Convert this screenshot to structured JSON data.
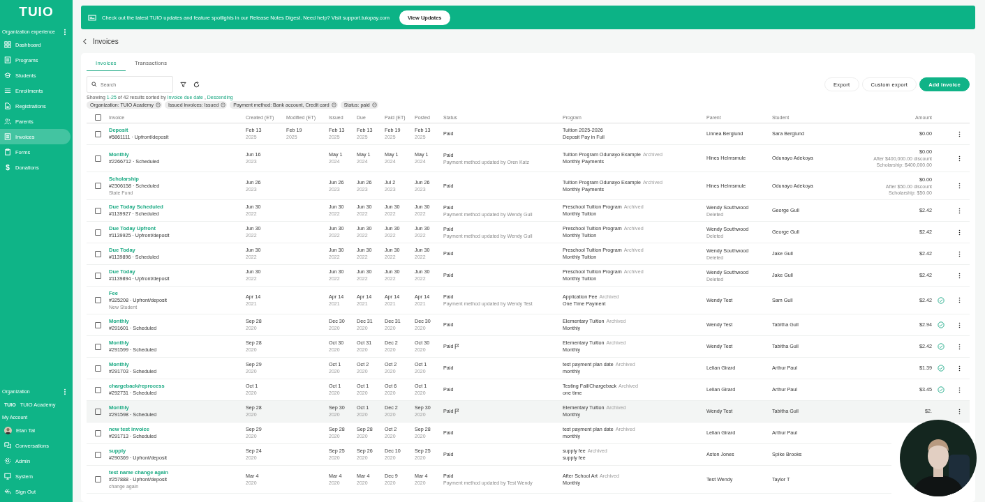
{
  "sidebar": {
    "logo": "TUIO",
    "section_title": "Organization experience",
    "items": [
      {
        "label": "Dashboard",
        "selected": false
      },
      {
        "label": "Programs",
        "selected": false
      },
      {
        "label": "Students",
        "selected": false
      },
      {
        "label": "Enrollments",
        "selected": false
      },
      {
        "label": "Registrations",
        "selected": false
      },
      {
        "label": "Parents",
        "selected": false
      },
      {
        "label": "Invoices",
        "selected": true
      },
      {
        "label": "Forms",
        "selected": false
      },
      {
        "label": "Donations",
        "selected": false,
        "glyph": "$"
      }
    ],
    "org_title": "Organization",
    "org_logo": "TUIO",
    "org_name": "TUIO Academy",
    "account_title": "My Account",
    "user_name": "Etan Tal",
    "account_items": [
      {
        "label": "Conversations"
      },
      {
        "label": "Admin"
      },
      {
        "label": "System"
      },
      {
        "label": "Sign Out"
      }
    ]
  },
  "banner": {
    "text": "Check out the latest TUIO updates and feature spotlights in our Release Notes Digest. Need help? Visit support.tuiopay.com",
    "button": "View Updates"
  },
  "page_title": "Invoices",
  "tabs": [
    {
      "label": "Invoices",
      "selected": true
    },
    {
      "label": "Transactions",
      "selected": false
    }
  ],
  "search": {
    "placeholder": "Search"
  },
  "actions": [
    "Export",
    "Custom export",
    "Add invoice"
  ],
  "summary": {
    "prefix": "Showing",
    "range": "1-25",
    "middle": "of 42 results sorted by",
    "sort": "Invoice due date",
    "sep": ",",
    "order": "Descending"
  },
  "filters": [
    "Organization: TUIO Academy",
    "Issued invoices: Issued",
    "Payment method: Bank account, Credit card",
    "Status: paid"
  ],
  "table": {
    "all_checked": false,
    "columns": [
      "Invoice",
      "Created (ET)",
      "Modified (ET)",
      "Issued",
      "Due",
      "Paid (ET)",
      "Posted",
      "Status",
      "Program",
      "Parent",
      "Student",
      "Amount"
    ],
    "rows": [
      {
        "title": "Deposit",
        "ref": "#5861111 · Upfront/deposit",
        "created": [
          "Feb 13",
          "2025"
        ],
        "modified": [
          "Feb 19",
          "2025"
        ],
        "issued": [
          "Feb 13",
          "2025"
        ],
        "due": [
          "Feb 13",
          "2025"
        ],
        "paid": [
          "Feb 19",
          "2025"
        ],
        "posted": [
          "Feb 13",
          "2025"
        ],
        "status": "Paid",
        "flag": false,
        "program": "Tuition 2025-2026",
        "plan": "Deposit Pay in Full",
        "parent": "Linnea Berglund",
        "student": "Sara Berglund",
        "amount": "$0.00",
        "verified": false,
        "actions": true,
        "checked": false,
        "highlighted": false
      },
      {
        "title": "Monthly",
        "ref": "#2266712 · Scheduled",
        "created": [
          "Jun 16",
          "2023"
        ],
        "issued": [
          "May 1",
          "2024"
        ],
        "due": [
          "May 1",
          "2024"
        ],
        "paid": [
          "May 1",
          "2024"
        ],
        "posted": [
          "May 1",
          "2024"
        ],
        "status": "Paid",
        "status_note": "Payment method updated by Oren Katz",
        "flag": false,
        "program": "Tuition Program Odunayo Example",
        "program_tag": "Archived",
        "plan": "Monthly Payments",
        "parent": "Hines Helmsmule",
        "student": "Odunayo Adekoya",
        "amount": "$0.00",
        "amount_notes": [
          "After $400,000.00 discount",
          "Scholarship: $400,000.00"
        ],
        "verified": false,
        "actions": true,
        "checked": false,
        "highlighted": false
      },
      {
        "title": "Scholarship",
        "ref": "#2306158 · Scheduled",
        "note": "State Fund",
        "created": [
          "Jun 26",
          "2023"
        ],
        "issued": [
          "Jun 26",
          "2023"
        ],
        "due": [
          "Jun 26",
          "2023"
        ],
        "paid": [
          "Jul 2",
          "2023"
        ],
        "posted": [
          "Jun 26",
          "2023"
        ],
        "status": "Paid",
        "flag": false,
        "program": "Tuition Program Odunayo Example",
        "program_tag": "Archived",
        "plan": "Monthly Payments",
        "parent": "Hines Helmsmule",
        "student": "Odunayo Adekoya",
        "amount": "$0.00",
        "amount_notes": [
          "After $50.00 discount",
          "Scholarship: $50.00"
        ],
        "verified": false,
        "actions": true,
        "checked": false,
        "highlighted": false
      },
      {
        "title": "Due Today Scheduled",
        "ref": "#1139927 · Scheduled",
        "created": [
          "Jun 30",
          "2022"
        ],
        "issued": [
          "Jun 30",
          "2022"
        ],
        "due": [
          "Jun 30",
          "2022"
        ],
        "paid": [
          "Jun 30",
          "2022"
        ],
        "posted": [
          "Jun 30",
          "2022"
        ],
        "status": "Paid",
        "status_note": "Payment method updated by Wendy Gull",
        "flag": false,
        "program": "Preschool Tuition Program",
        "program_tag": "Archived",
        "plan": "Monthly Tuition",
        "parent": "Wendy Southwood",
        "parent_note": "Deleted",
        "student": "George Gull",
        "amount": "$2.42",
        "verified": false,
        "actions": true,
        "checked": false,
        "highlighted": false
      },
      {
        "title": "Due Today Upfront",
        "ref": "#1139925 · Upfront/deposit",
        "created": [
          "Jun 30",
          "2022"
        ],
        "issued": [
          "Jun 30",
          "2022"
        ],
        "due": [
          "Jun 30",
          "2022"
        ],
        "paid": [
          "Jun 30",
          "2022"
        ],
        "posted": [
          "Jun 30",
          "2022"
        ],
        "status": "Paid",
        "status_note": "Payment method updated by Wendy Gull",
        "flag": false,
        "program": "Preschool Tuition Program",
        "program_tag": "Archived",
        "plan": "Monthly Tuition",
        "parent": "Wendy Southwood",
        "parent_note": "Deleted",
        "student": "George Gull",
        "amount": "$2.42",
        "verified": false,
        "actions": true,
        "checked": false,
        "highlighted": false
      },
      {
        "title": "Due Today",
        "ref": "#1139896 · Scheduled",
        "created": [
          "Jun 30",
          "2022"
        ],
        "issued": [
          "Jun 30",
          "2022"
        ],
        "due": [
          "Jun 30",
          "2022"
        ],
        "paid": [
          "Jun 30",
          "2022"
        ],
        "posted": [
          "Jun 30",
          "2022"
        ],
        "status": "Paid",
        "flag": false,
        "program": "Preschool Tuition Program",
        "program_tag": "Archived",
        "plan": "Monthly Tuition",
        "parent": "Wendy Southwood",
        "parent_note": "Deleted",
        "student": "Jake Gull",
        "amount": "$2.42",
        "verified": false,
        "actions": true,
        "checked": false,
        "highlighted": false
      },
      {
        "title": "Due Today",
        "ref": "#1139894 · Upfront/deposit",
        "created": [
          "Jun 30",
          "2022"
        ],
        "issued": [
          "Jun 30",
          "2022"
        ],
        "due": [
          "Jun 30",
          "2022"
        ],
        "paid": [
          "Jun 30",
          "2022"
        ],
        "posted": [
          "Jun 30",
          "2022"
        ],
        "status": "Paid",
        "flag": false,
        "program": "Preschool Tuition Program",
        "program_tag": "Archived",
        "plan": "Monthly Tuition",
        "parent": "Wendy Southwood",
        "parent_note": "Deleted",
        "student": "Jake Gull",
        "amount": "$2.42",
        "verified": false,
        "actions": true,
        "checked": false,
        "highlighted": false
      },
      {
        "title": "Fee",
        "ref": "#325208 · Upfront/deposit",
        "note": "New Student",
        "created": [
          "Apr 14",
          "2021"
        ],
        "issued": [
          "Apr 14",
          "2021"
        ],
        "due": [
          "Apr 14",
          "2021"
        ],
        "paid": [
          "Apr 14",
          "2021"
        ],
        "posted": [
          "Apr 14",
          "2021"
        ],
        "status": "Paid",
        "status_note": "Payment method updated by Wendy Test",
        "flag": false,
        "program": "Application Fee",
        "program_tag": "Archived",
        "plan": "One Time Payment",
        "parent": "Wendy Test",
        "student": "Sam Gull",
        "amount": "$2.42",
        "verified": true,
        "actions": true,
        "checked": false,
        "highlighted": false
      },
      {
        "title": "Monthly",
        "ref": "#291601 · Scheduled",
        "created": [
          "Sep 28",
          "2020"
        ],
        "issued": [
          "Dec 30",
          "2020"
        ],
        "due": [
          "Dec 31",
          "2020"
        ],
        "paid": [
          "Dec 31",
          "2020"
        ],
        "posted": [
          "Dec 30",
          "2020"
        ],
        "status": "Paid",
        "flag": false,
        "program": "Elementary Tuition",
        "program_tag": "Archived",
        "plan": "Monthly",
        "parent": "Wendy Test",
        "student": "Tabitha Gull",
        "amount": "$2.94",
        "verified": true,
        "actions": true,
        "checked": false,
        "highlighted": false
      },
      {
        "title": "Monthly",
        "ref": "#291599 · Scheduled",
        "created": [
          "Sep 28",
          "2020"
        ],
        "issued": [
          "Oct 30",
          "2020"
        ],
        "due": [
          "Oct 31",
          "2020"
        ],
        "paid": [
          "Dec 2",
          "2020"
        ],
        "posted": [
          "Oct 30",
          "2020"
        ],
        "status": "Paid",
        "flag": true,
        "program": "Elementary Tuition",
        "program_tag": "Archived",
        "plan": "Monthly",
        "parent": "Wendy Test",
        "student": "Tabitha Gull",
        "amount": "$2.42",
        "verified": true,
        "actions": true,
        "checked": false,
        "highlighted": false
      },
      {
        "title": "Monthly",
        "ref": "#291703 · Scheduled",
        "created": [
          "Sep 29",
          "2020"
        ],
        "issued": [
          "Oct 1",
          "2020"
        ],
        "due": [
          "Oct 2",
          "2020"
        ],
        "paid": [
          "Oct 2",
          "2020"
        ],
        "posted": [
          "Oct 1",
          "2020"
        ],
        "status": "Paid",
        "flag": false,
        "program": "test payment plan date",
        "program_tag": "Archived",
        "plan": "monthly",
        "parent": "Lelian Girard",
        "student": "Arthur Paul",
        "amount": "$1.39",
        "verified": true,
        "actions": true,
        "checked": false,
        "highlighted": false
      },
      {
        "title": "chargeback/reprocess",
        "ref": "#292731 · Scheduled",
        "created": [
          "Oct 1",
          "2020"
        ],
        "issued": [
          "Oct 1",
          "2020"
        ],
        "due": [
          "Oct 1",
          "2020"
        ],
        "paid": [
          "Oct 6",
          "2020"
        ],
        "posted": [
          "Oct 1",
          "2020"
        ],
        "status": "Paid",
        "flag": false,
        "program": "Testing Fail/Chargeback",
        "program_tag": "Archived",
        "plan": "one time",
        "parent": "Lelian Girard",
        "student": "Arthur Paul",
        "amount": "$3.45",
        "verified": true,
        "actions": true,
        "checked": false,
        "highlighted": false
      },
      {
        "title": "Monthly",
        "ref": "#291598 · Scheduled",
        "created": [
          "Sep 28",
          "2020"
        ],
        "issued": [
          "Sep 30",
          "2020"
        ],
        "due": [
          "Oct 1",
          "2020"
        ],
        "paid": [
          "Dec 2",
          "2020"
        ],
        "posted": [
          "Sep 30",
          "2020"
        ],
        "status": "Paid",
        "flag": true,
        "program": "Elementary Tuition",
        "program_tag": "Archived",
        "plan": "Monthly",
        "parent": "Wendy Test",
        "student": "Tabitha Gull",
        "amount": "$2.",
        "verified": false,
        "actions": true,
        "checked": false,
        "highlighted": true
      },
      {
        "title": "new test invoice",
        "ref": "#291713 · Scheduled",
        "created": [
          "Sep 29",
          "2020"
        ],
        "issued": [
          "Sep 28",
          "2020"
        ],
        "due": [
          "Sep 28",
          "2020"
        ],
        "paid": [
          "Oct 2",
          "2020"
        ],
        "posted": [
          "Sep 28",
          "2020"
        ],
        "status": "Paid",
        "flag": false,
        "program": "test payment plan date",
        "program_tag": "Archived",
        "plan": "monthly",
        "parent": "Lelian Girard",
        "student": "Arthur Paul",
        "verified": false,
        "actions": false,
        "checked": false,
        "highlighted": false
      },
      {
        "title": "supply",
        "ref": "#290369 · Upfront/deposit",
        "created": [
          "Sep 24",
          "2020"
        ],
        "issued": [
          "Sep 25",
          "2020"
        ],
        "due": [
          "Sep 26",
          "2020"
        ],
        "paid": [
          "Dec 10",
          "2020"
        ],
        "posted": [
          "Sep 25",
          "2020"
        ],
        "status": "Paid",
        "flag": false,
        "program": "supply fee",
        "program_tag": "Archived",
        "plan": "supply fee",
        "parent": "Aston Jones",
        "student": "Spike Brooks",
        "verified": false,
        "actions": false,
        "checked": false,
        "highlighted": false
      },
      {
        "title": "test name change again",
        "ref": "#257888 · Upfront/deposit",
        "note": "change again",
        "created": [
          "Mar 4",
          "2020"
        ],
        "issued": [
          "Mar 4",
          "2020"
        ],
        "due": [
          "Mar 4",
          "2020"
        ],
        "paid": [
          "Dec 9",
          "2020"
        ],
        "posted": [
          "Mar 4",
          "2020"
        ],
        "status": "Paid",
        "status_note": "Payment method updated by Test Wendy",
        "flag": false,
        "program": "After School Art",
        "program_tag": "Archived",
        "plan": "Monthly",
        "parent": "Test Wendy",
        "student": "Taylor T",
        "verified": false,
        "actions": false,
        "checked": false,
        "highlighted": false
      }
    ]
  },
  "webcam": {
    "kind": "picture"
  }
}
